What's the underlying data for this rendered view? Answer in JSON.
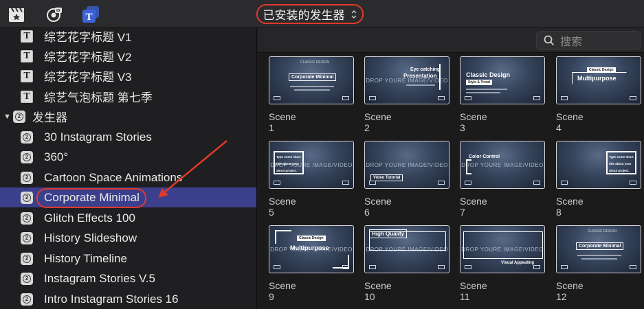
{
  "toolbar": {
    "icons": [
      "clapper-star-icon",
      "music-camera-icon",
      "titles-icon"
    ],
    "dropdown_label": "已安装的发生器",
    "dropdown_chevron": "⌃⌄"
  },
  "sidebar": {
    "items": [
      {
        "label": "综艺花字标题 V1",
        "icon": "T",
        "type": "title"
      },
      {
        "label": "综艺花字标题 V2",
        "icon": "T",
        "type": "title"
      },
      {
        "label": "综艺花字标题 V3",
        "icon": "T",
        "type": "title"
      },
      {
        "label": "综艺气泡标题 第七季",
        "icon": "T",
        "type": "title"
      },
      {
        "label": "发生器",
        "icon": "2",
        "type": "group"
      },
      {
        "label": "30 Instagram Stories",
        "icon": "2",
        "type": "generator"
      },
      {
        "label": "360°",
        "icon": "2",
        "type": "generator"
      },
      {
        "label": "Cartoon Space Animations",
        "icon": "2",
        "type": "generator"
      },
      {
        "label": "Corporate Minimal",
        "icon": "2",
        "type": "generator",
        "selected": true
      },
      {
        "label": "Glitch Effects 100",
        "icon": "2",
        "type": "generator"
      },
      {
        "label": "History Slideshow",
        "icon": "2",
        "type": "generator"
      },
      {
        "label": "History Timeline",
        "icon": "2",
        "type": "generator"
      },
      {
        "label": "Instagram Stories V.5",
        "icon": "2",
        "type": "generator"
      },
      {
        "label": "Intro Instagram Stories 16",
        "icon": "2",
        "type": "generator"
      }
    ],
    "group_toggle": "▼"
  },
  "search": {
    "placeholder": "搜索"
  },
  "scenes": [
    {
      "label": "Scene 1",
      "big": "",
      "texts": [
        "CLASSIC DESIGN",
        "Corporate Minimal"
      ]
    },
    {
      "label": "Scene 2",
      "big": "DROP YOURE IMAGE/VIDEO",
      "texts": [
        "Eye catching",
        "Presentation"
      ]
    },
    {
      "label": "Scene 3",
      "big": "",
      "texts": [
        "Classic Design",
        "Style & Trend"
      ]
    },
    {
      "label": "Scene 4",
      "big": "",
      "texts": [
        "Classic Design",
        "Multipurpose"
      ]
    },
    {
      "label": "Scene 5",
      "big": "DROP YOURE IMAGE/VIDEO",
      "texts": [
        "Type some short",
        "title about your",
        "about project."
      ]
    },
    {
      "label": "Scene 6",
      "big": "DROP YOURE IMAGE/VIDEO",
      "texts": [
        "Video Tutorial"
      ]
    },
    {
      "label": "Scene 7",
      "big": "DROP YOURE IMAGE/VIDEO",
      "texts": [
        "Color Control"
      ]
    },
    {
      "label": "Scene 8",
      "big": "",
      "texts": [
        "Type some short",
        "title about your",
        "about project."
      ]
    },
    {
      "label": "Scene 9",
      "big": "DROP YOURE IMAGE/VIDEO",
      "texts": [
        "Classic Design",
        "Multipurpose"
      ]
    },
    {
      "label": "Scene 10",
      "big": "DROP YOURE IMAGE/VIDEO",
      "texts": [
        "High Quality"
      ]
    },
    {
      "label": "Scene 11",
      "big": "DROP YOURE IMAGE/VIDEO",
      "texts": [
        "Visual Appealing"
      ]
    },
    {
      "label": "Scene 12",
      "big": "",
      "texts": [
        "CLASSIC DESIGN",
        "Corporate Minimal"
      ]
    }
  ],
  "colors": {
    "accent_red": "#e0392b",
    "selection": "#3b3f8c",
    "icon_blue": "#3c64d8"
  }
}
